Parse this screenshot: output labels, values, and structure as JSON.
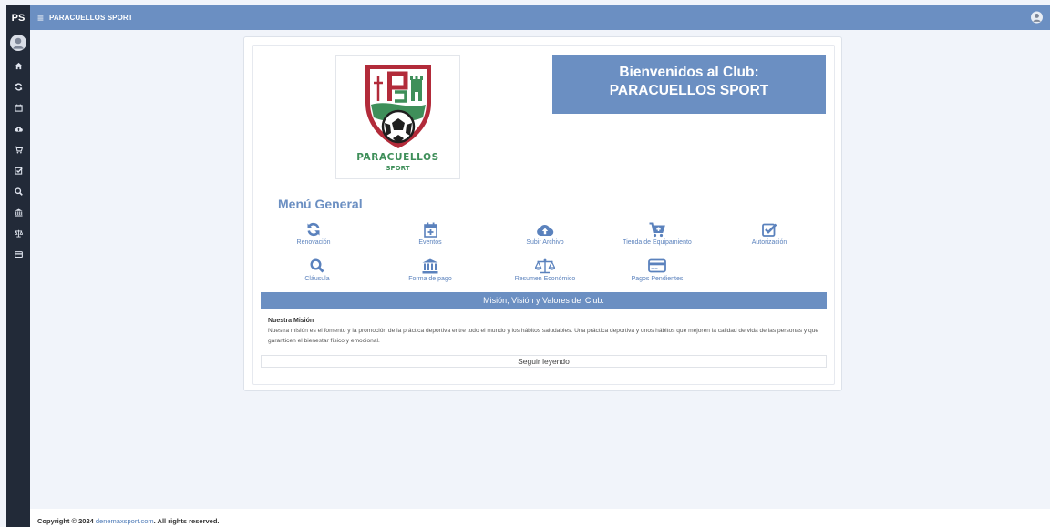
{
  "header": {
    "brand": "PS",
    "title": "PARACUELLOS SPORT",
    "menu_icon": "hamburger-icon",
    "avatar_icon": "user-icon"
  },
  "sidebar": {
    "items": [
      {
        "icon": "home-icon"
      },
      {
        "icon": "refresh-icon"
      },
      {
        "icon": "calendar-icon"
      },
      {
        "icon": "cloud-upload-icon"
      },
      {
        "icon": "cart-icon"
      },
      {
        "icon": "check-square-icon"
      },
      {
        "icon": "search-icon"
      },
      {
        "icon": "bank-icon"
      },
      {
        "icon": "balance-scale-icon"
      },
      {
        "icon": "credit-card-icon"
      }
    ]
  },
  "logo": {
    "name": "PARACUELLOS",
    "subname": "SPORT"
  },
  "welcome": {
    "line1": "Bienvenidos al Club:",
    "line2": "PARACUELLOS SPORT"
  },
  "menu": {
    "title": "Menú General",
    "items": [
      {
        "label": "Renovación",
        "icon": "refresh-icon"
      },
      {
        "label": "Eventos",
        "icon": "calendar-plus-icon"
      },
      {
        "label": "Subir Archivo",
        "icon": "cloud-upload-icon"
      },
      {
        "label": "Tienda de Equipamiento",
        "icon": "cart-plus-icon"
      },
      {
        "label": "Autorización",
        "icon": "check-square-icon"
      },
      {
        "label": "Cláusula",
        "icon": "search-icon"
      },
      {
        "label": "Forma de pago",
        "icon": "bank-icon"
      },
      {
        "label": "Resumen Económico",
        "icon": "balance-scale-icon"
      },
      {
        "label": "Pagos Pendientes",
        "icon": "credit-card-icon"
      }
    ]
  },
  "mission": {
    "bar": "Misión, Visión y Valores del Club.",
    "heading": "Nuestra Misión",
    "text": "Nuestra misión es el fomento y la promoción de la práctica deportiva entre todo el mundo y los hábitos saludables. Una práctica deportiva y unos hábitos que mejoren la calidad de vida de las personas y que garanticen el bienestar físico y emocional.",
    "read_more": "Seguir leyendo"
  },
  "footer": {
    "prefix": "Copyright © 2024 ",
    "link": "denemaxsport.com",
    "suffix": ". All rights reserved."
  },
  "colors": {
    "accent": "#6b8fc2",
    "sidebar": "#222a38",
    "background": "#f1f4fa",
    "logo_red": "#b22b3a",
    "logo_green": "#3f8f5a"
  }
}
